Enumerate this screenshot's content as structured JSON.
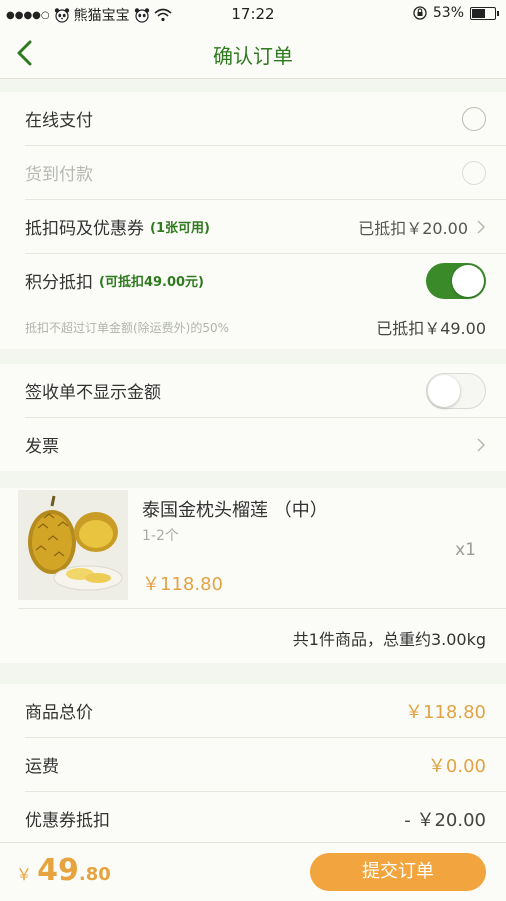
{
  "status_bar": {
    "signal_dots": "●●●●○",
    "carrier": "熊猫宝宝",
    "time": "17:22",
    "battery": "53%",
    "battery_level": 0.53,
    "icons": [
      "panda-icon",
      "wifi-icon",
      "orientation-lock-icon",
      "battery-icon"
    ]
  },
  "header": {
    "title": "确认订单",
    "accent_color": "#2f7a1f"
  },
  "payment": {
    "online_label": "在线支付",
    "cod_label": "货到付款",
    "coupon_label": "抵扣码及优惠券",
    "coupon_available": "(1张可用)",
    "coupon_applied": "已抵扣￥20.00",
    "points_label": "积分抵扣",
    "points_available": "(可抵扣49.00元)",
    "points_toggle_on": true,
    "points_note": "抵扣不超过订单金额(除运费外)的50%",
    "points_applied": "已抵扣￥49.00"
  },
  "options": {
    "hide_amount_label": "签收单不显示金额",
    "hide_amount_toggle_on": false,
    "invoice_label": "发票"
  },
  "product": {
    "name": "泰国金枕头榴莲 （中）",
    "spec": "1-2个",
    "quantity": "x1",
    "price": "￥118.80",
    "summary": "共1件商品，总重约3.00kg"
  },
  "price_summary": {
    "items_total_label": "商品总价",
    "items_total": "￥118.80",
    "shipping_label": "运费",
    "shipping": "￥0.00",
    "coupon_discount_label": "优惠券抵扣",
    "coupon_discount": "- ￥20.00"
  },
  "footer": {
    "currency": "￥",
    "total_int": "49",
    "total_dec": ".80",
    "submit_label": "提交订单",
    "submit_color": "#f2a53f",
    "total_color": "#e6a33f"
  }
}
